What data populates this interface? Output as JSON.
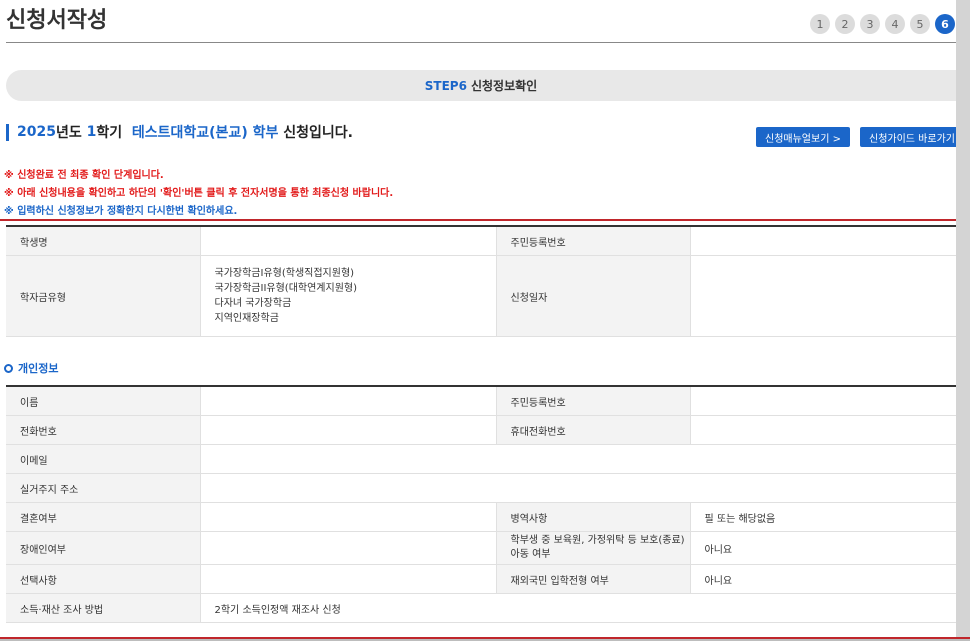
{
  "page": {
    "title": "신청서작성"
  },
  "steps": [
    "1",
    "2",
    "3",
    "4",
    "5",
    "6"
  ],
  "step_banner": {
    "code": "STEP6",
    "label": "신청정보확인"
  },
  "headline": {
    "year": "2025",
    "year_suffix": "년도",
    "term": "1",
    "term_suffix": "학기",
    "school": "테스트대학교(본교) 학부",
    "tail": "신청입니다."
  },
  "buttons": {
    "manual": "신청매뉴얼보기 >",
    "guide": "신청가이드 바로가기"
  },
  "notices": [
    "※ 신청완료 전 최종 확인 단계입니다.",
    "※ 아래 신청내용을 확인하고 하단의 '확인'버튼 클릭 후 전자서명을 통한 최종신청 바랍니다.",
    "※ 입력하신 신청정보가 정확한지 다시한번 확인하세요."
  ],
  "summary": {
    "student_name_label": "학생명",
    "rrn_label": "주민등록번호",
    "scholarship_type_label": "학자금유형",
    "scholarship_types": [
      "국가장학금I유형(학생직접지원형)",
      "국가장학금II유형(대학연계지원형)",
      "다자녀 국가장학금",
      "지역인재장학금"
    ],
    "apply_date_label": "신청일자"
  },
  "personal": {
    "section_title": "개인정보",
    "name_label": "이름",
    "rrn_label": "주민등록번호",
    "phone_label": "전화번호",
    "mobile_label": "휴대전화번호",
    "email_label": "이메일",
    "address_label": "실거주지 주소",
    "marriage_label": "결혼여부",
    "military_label": "병역사항",
    "military_value": "필 또는 해당없음",
    "disability_label": "장애인여부",
    "childcare_label": "학부생 중 보육원, 가정위탁 등 보호(종료)아동 여부",
    "childcare_value": "아니요",
    "selection_label": "선택사항",
    "overseas_label": "재외국민 입학전형 여부",
    "overseas_value": "아니요",
    "income_label": "소득·재산 조사 방법",
    "income_value": "2학기 소득인정액 재조사 신청"
  }
}
